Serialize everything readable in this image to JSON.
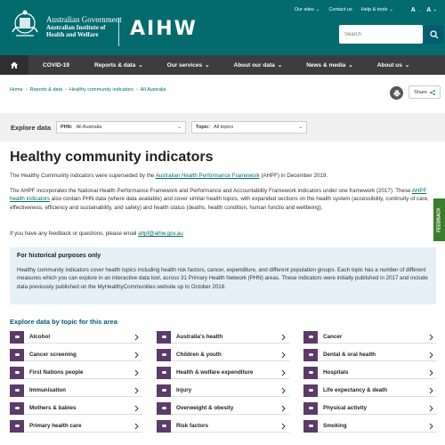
{
  "header": {
    "gov_line1": "Australian Government",
    "gov_line2": "Australian Institute of",
    "gov_line3": "Health and Welfare",
    "brand": "AIHW",
    "top_links": [
      "Our sites",
      "Contact us",
      "Help & tools"
    ],
    "font_small": "A",
    "font_large": "A",
    "search_placeholder": "Search"
  },
  "nav": {
    "items": [
      "COVID-19",
      "Reports & data",
      "Our services",
      "About our data",
      "News & media",
      "About us"
    ]
  },
  "breadcrumb": [
    "Home",
    "Reports & data",
    "Healthy community indicators",
    "All Australia"
  ],
  "share_label": "Share",
  "explore": {
    "label": "Explore data",
    "phn_label": "PHN:",
    "phn_value": "All Australia",
    "topic_label": "Topic:",
    "topic_value": "All topics"
  },
  "page": {
    "title": "Healthy community indicators",
    "p1_before": "The Healthy Community indicators were superseded by the ",
    "p1_link": "Australian Health Performance Framework",
    "p1_after": " (AHPF) in December 2019.",
    "p2_before": "The AHPF incorporates the National Health Performance Framework and Performance and Accountability Framework indicators under one framework (2017). These ",
    "p2_link": "AHPF health indicators",
    "p2_after": " also contain PHN data (where data available) and cover similar health topics, with expanded sections on the health system (accessibility, continuity of care, effectiveness, efficiency and sustainability, and safety) and health status (deaths, health condition, human functio and wellbeing).",
    "p3_before": "If you have any feedback or questions, please email ",
    "p3_link": "ahpf@aihw.gov.au",
    "historic_title": "For historical purposes only",
    "historic_text": "Healthy community indicators cover health topics including health risk factors, cancer, expenditure, and different population groups. Each topic has a number of different measures which you can explore in an interactive data tool, across 31 Primary Health Network (PHN) areas. These indicators were initially published in 2017 and include data previously published on the MyHealthyCommunities website up to October 2018.",
    "topics_heading": "Explore data by topic for this area"
  },
  "topics": [
    "Alcohol",
    "Australia's health",
    "Cancer",
    "Cancer screening",
    "Children & youth",
    "Dental & oral health",
    "First Nations people",
    "Health & welfare expenditure",
    "Hospitals",
    "Immunisation",
    "Injury",
    "Life expectancy & death",
    "Mothers & babies",
    "Overweight & obesity",
    "Physical activity",
    "Primary health care",
    "Risk factors",
    "Smoking"
  ],
  "feedback_label": "FEEDBACK",
  "colors": {
    "header": "#036b6e",
    "nav": "#3d3d3d",
    "topic_icon": "#5b3b69",
    "feedback": "#3a7d2b"
  }
}
